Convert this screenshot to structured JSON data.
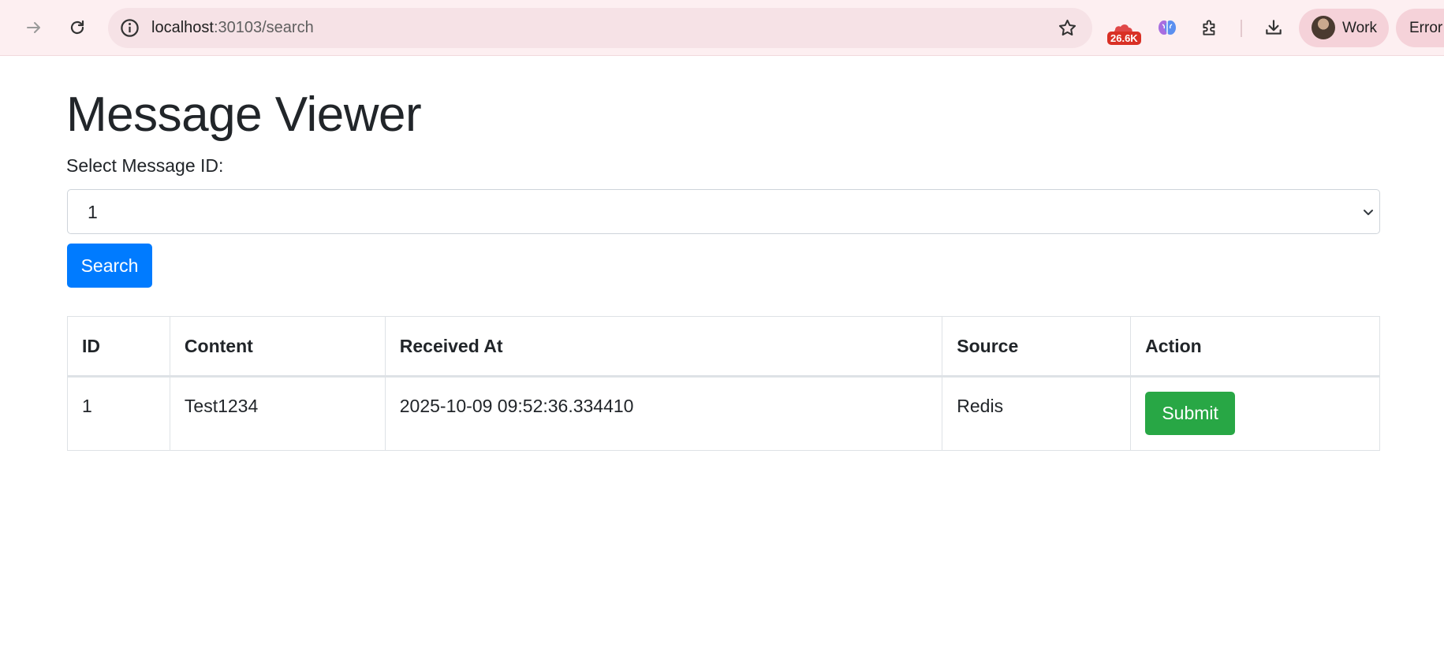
{
  "browser": {
    "url_host": "localhost",
    "url_path": ":30103/search",
    "extension_badge": "26.6K",
    "profile_label": "Work",
    "error_label": "Error"
  },
  "page": {
    "title": "Message Viewer",
    "select_label": "Select Message ID:",
    "selected_id": "1",
    "search_button": "Search"
  },
  "table": {
    "headers": [
      "ID",
      "Content",
      "Received At",
      "Source",
      "Action"
    ],
    "rows": [
      {
        "id": "1",
        "content": "Test1234",
        "received_at": "2025-10-09 09:52:36.334410",
        "source": "Redis",
        "action": "Submit"
      }
    ]
  },
  "colors": {
    "primary": "#007bff",
    "success": "#28a745",
    "text": "#212529",
    "chrome_bg": "#fdeff1"
  }
}
